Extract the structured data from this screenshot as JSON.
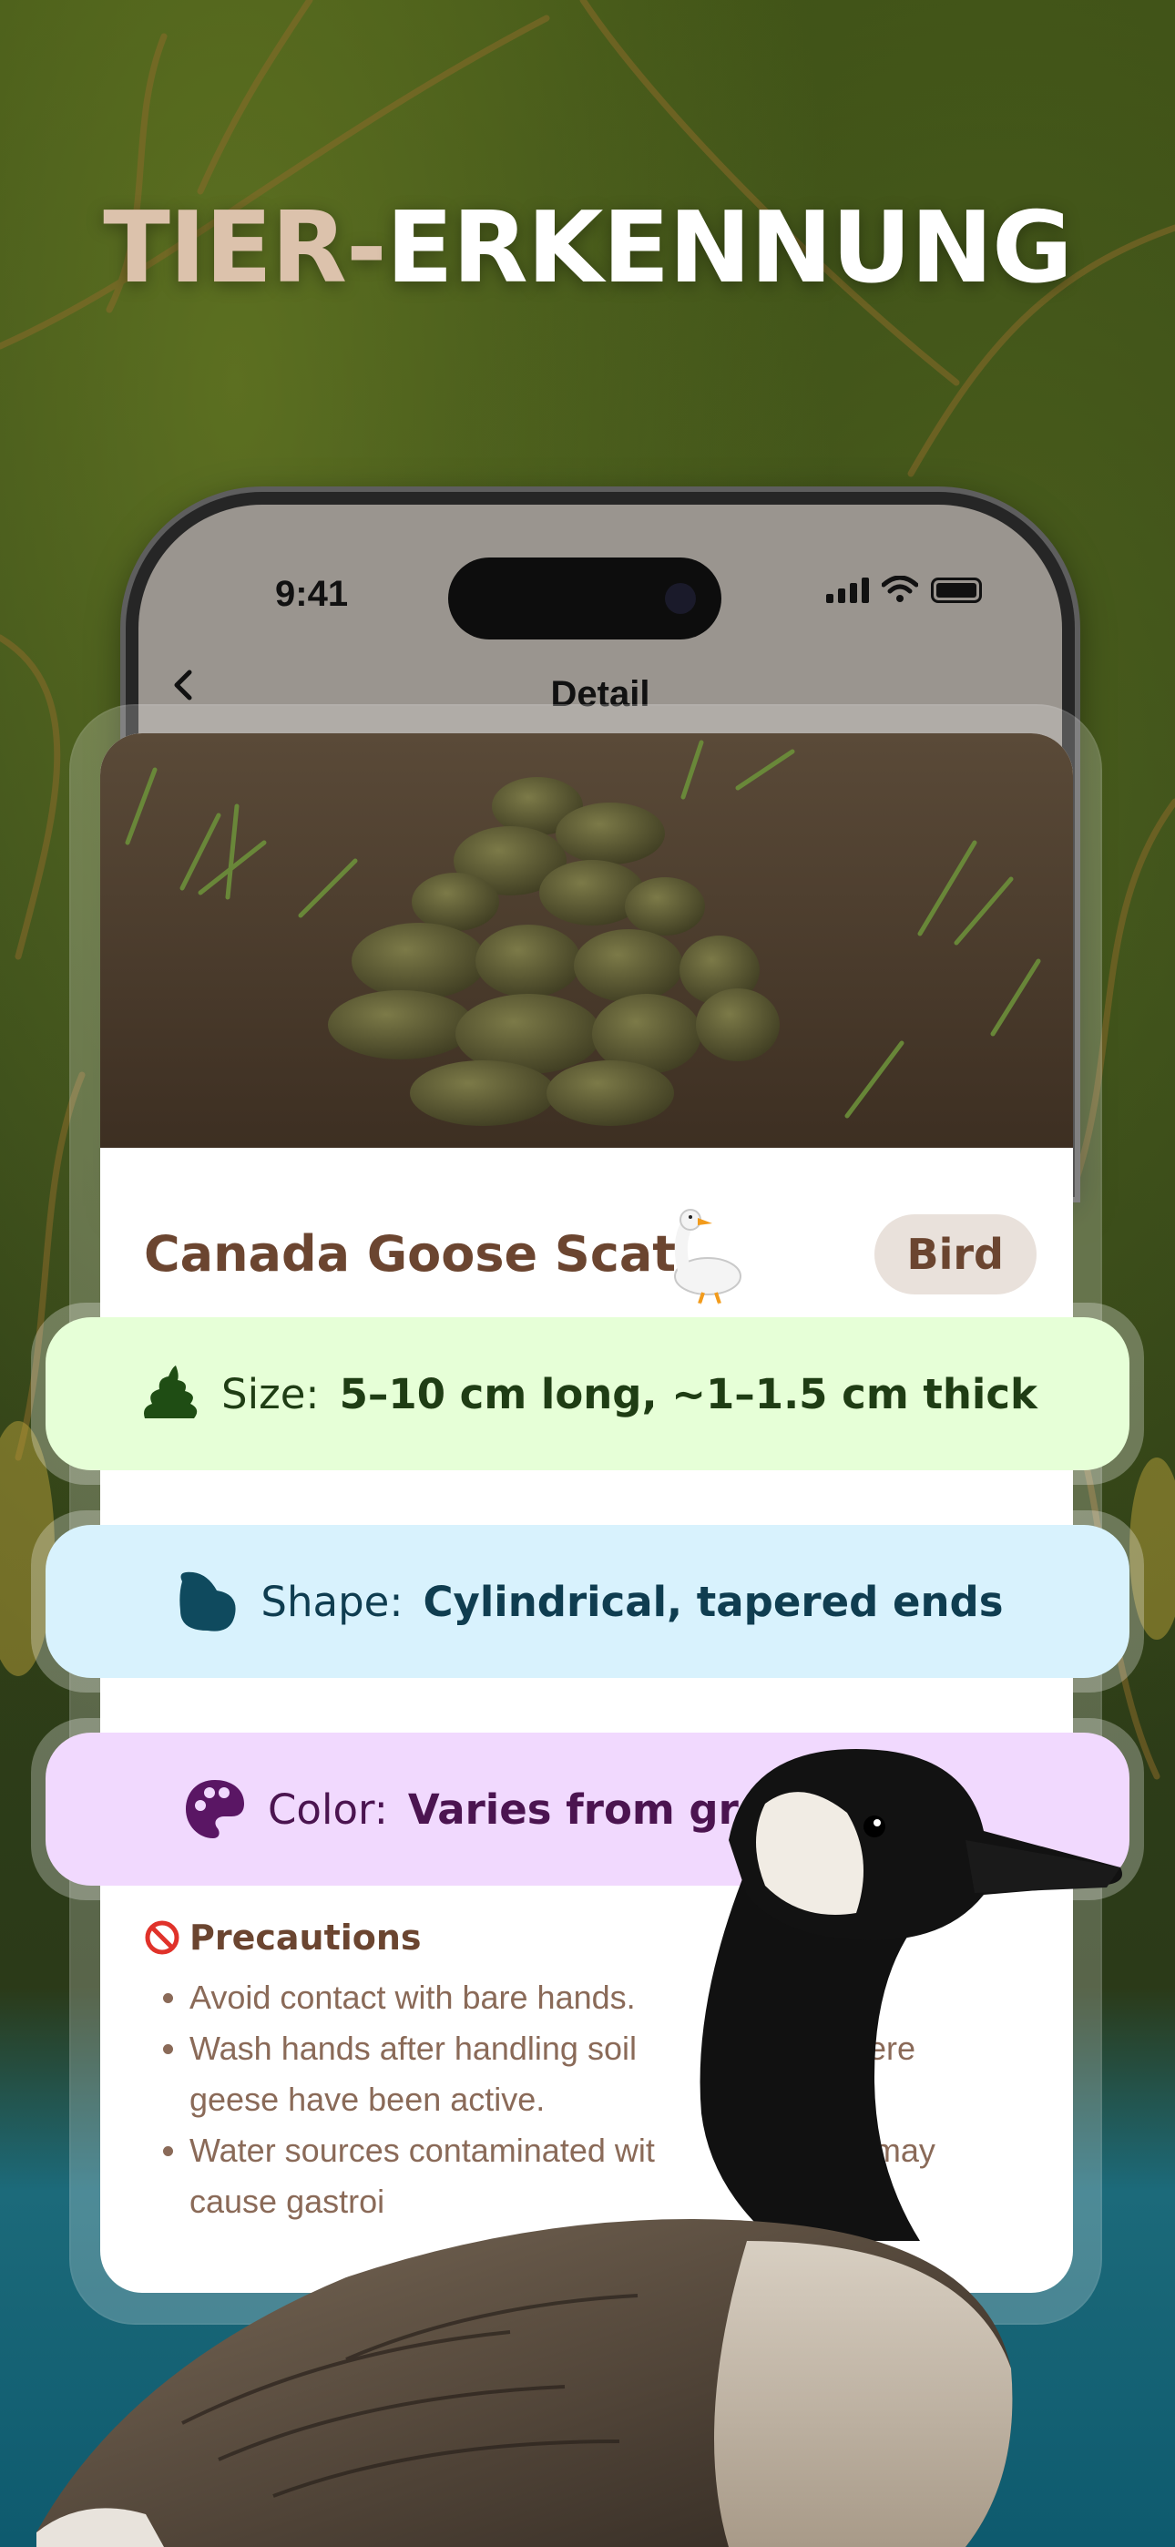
{
  "headline": {
    "part1": "TIER-",
    "part2": "ERKENNUNG"
  },
  "status_bar": {
    "time": "9:41"
  },
  "nav": {
    "title": "Detail",
    "back_icon": "chevron-left-icon"
  },
  "card": {
    "title": "Canada Goose Scat",
    "title_emoji": "goose-icon",
    "badge": "Bird",
    "attributes": [
      {
        "icon": "poop-icon",
        "label": "Size:",
        "value": "5–10 cm long, ~1–1.5 cm thick",
        "color": "#e6ffd7"
      },
      {
        "icon": "blob-shape-icon",
        "label": "Shape:",
        "value": "Cylindrical, tapered ends",
        "color": "#d8f2fd"
      },
      {
        "icon": "palette-icon",
        "label": "Color:",
        "value": "Varies from gre",
        "color": "#f1d9fe"
      }
    ],
    "precautions": {
      "title": "Precautions",
      "icon": "prohibited-icon",
      "items": [
        "Avoid contact with bare hands.",
        "Wash hands after handling soil",
        "es where",
        "geese have been active.",
        "Water sources contaminated wit",
        "at may",
        "cause gastroi"
      ]
    }
  }
}
